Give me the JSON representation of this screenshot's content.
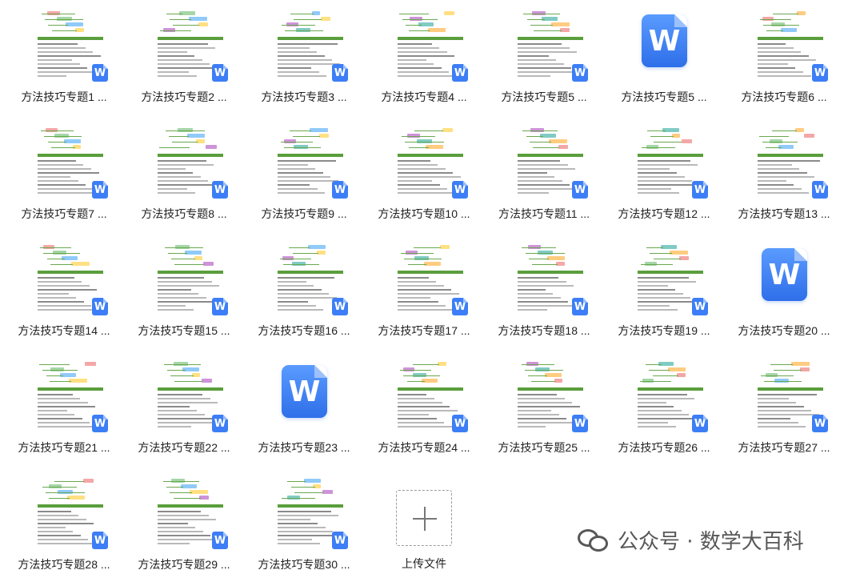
{
  "files": [
    {
      "name": "方法技巧专题1 ...",
      "thumb": "doc"
    },
    {
      "name": "方法技巧专题2 ...",
      "thumb": "doc"
    },
    {
      "name": "方法技巧专题3 ...",
      "thumb": "doc"
    },
    {
      "name": "方法技巧专题4 ...",
      "thumb": "doc"
    },
    {
      "name": "方法技巧专题5 ...",
      "thumb": "doc"
    },
    {
      "name": "方法技巧专题5 ...",
      "thumb": "icon"
    },
    {
      "name": "方法技巧专题6 ...",
      "thumb": "doc"
    },
    {
      "name": "方法技巧专题7 ...",
      "thumb": "doc"
    },
    {
      "name": "方法技巧专题8 ...",
      "thumb": "doc"
    },
    {
      "name": "方法技巧专题9 ...",
      "thumb": "doc"
    },
    {
      "name": "方法技巧专题10 ...",
      "thumb": "doc"
    },
    {
      "name": "方法技巧专题11 ...",
      "thumb": "doc"
    },
    {
      "name": "方法技巧专题12 ...",
      "thumb": "doc"
    },
    {
      "name": "方法技巧专题13 ...",
      "thumb": "doc"
    },
    {
      "name": "方法技巧专题14 ...",
      "thumb": "doc"
    },
    {
      "name": "方法技巧专题15 ...",
      "thumb": "doc"
    },
    {
      "name": "方法技巧专题16 ...",
      "thumb": "doc"
    },
    {
      "name": "方法技巧专题17 ...",
      "thumb": "doc"
    },
    {
      "name": "方法技巧专题18 ...",
      "thumb": "doc"
    },
    {
      "name": "方法技巧专题19 ...",
      "thumb": "doc"
    },
    {
      "name": "方法技巧专题20 ...",
      "thumb": "icon"
    },
    {
      "name": "方法技巧专题21 ...",
      "thumb": "doc"
    },
    {
      "name": "方法技巧专题22 ...",
      "thumb": "doc"
    },
    {
      "name": "方法技巧专题23 ...",
      "thumb": "icon"
    },
    {
      "name": "方法技巧专题24 ...",
      "thumb": "doc"
    },
    {
      "name": "方法技巧专题25 ...",
      "thumb": "doc"
    },
    {
      "name": "方法技巧专题26 ...",
      "thumb": "doc"
    },
    {
      "name": "方法技巧专题27 ...",
      "thumb": "doc"
    },
    {
      "name": "方法技巧专题28 ...",
      "thumb": "doc"
    },
    {
      "name": "方法技巧专题29 ...",
      "thumb": "doc"
    },
    {
      "name": "方法技巧专题30 ...",
      "thumb": "doc"
    }
  ],
  "file_icon_letter": "W",
  "upload": {
    "label": "上传文件"
  },
  "watermark": {
    "text": "公众号 · 数学大百科"
  },
  "colors": {
    "wps_blue": "#3d7ef6",
    "doc_green": "#5a9e3c"
  }
}
